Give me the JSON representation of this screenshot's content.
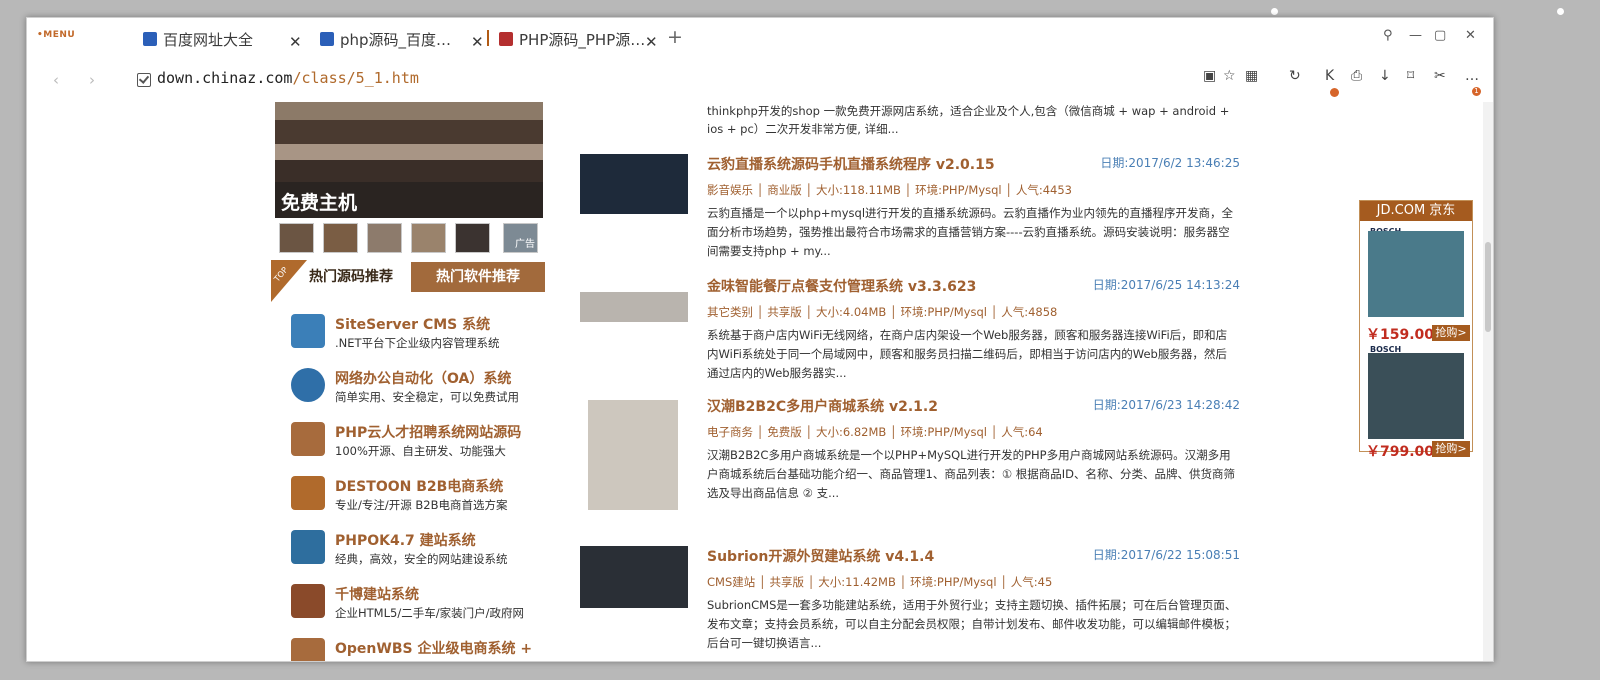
{
  "browser": {
    "menu_label": "•MENU",
    "tabs": [
      {
        "label": "百度网址大全",
        "icon": "paw-icon",
        "close": "✕"
      },
      {
        "label": "php源码_百度…",
        "icon": "paw-icon",
        "close": "✕"
      },
      {
        "label": "PHP源码_PHP源…",
        "icon": "php-icon",
        "close": "✕"
      }
    ],
    "new_tab": "+",
    "window_controls": [
      "⚲",
      "—",
      "▢",
      "✕"
    ],
    "back": "‹",
    "forward": "›",
    "url_host": "down.chinaz.com",
    "url_path": "/class/5_1.htm",
    "toolbar_icons": [
      "extension-icon",
      "star-icon",
      "qr-icon",
      "refresh-icon",
      "k-icon",
      "print-icon",
      "download-icon",
      "bookmark-icon",
      "cut-icon",
      "more-icon"
    ],
    "badge_count": "1"
  },
  "left": {
    "banner_text": "免费主机",
    "thumb_ad": "广告",
    "top_flag": "TOP",
    "tab_active": "热门源码推荐",
    "tab_inactive": "热门软件推荐",
    "items": [
      {
        "title": "SiteServer CMS 系统",
        "desc": ".NET平台下企业级内容管理系统",
        "color": "#3b7fb8"
      },
      {
        "title": "网络办公自动化（OA）系统",
        "desc": "简单实用、安全稳定，可以免费试用",
        "color": "#2f6fa8"
      },
      {
        "title": "PHP云人才招聘系统网站源码",
        "desc": "100%开源、自主研发、功能强大",
        "color": "#a76b3d"
      },
      {
        "title": "DESTOON B2B电商系统",
        "desc": "专业/专注/开源 B2B电商首选方案",
        "color": "#b06a2c"
      },
      {
        "title": "PHPOK4.7 建站系统",
        "desc": "经典，高效，安全的网站建设系统",
        "color": "#2e6e9e"
      },
      {
        "title": "千博建站系统",
        "desc": "企业HTML5/二手车/家装门户/政府网",
        "color": "#8a4a2a"
      },
      {
        "title": "OpenWBS 企业级电商系统 +",
        "desc": "",
        "color": "#a76b3d"
      }
    ]
  },
  "list": {
    "top_desc": "thinkphp开发的shop 一款免费开源网店系统，适合企业及个人,包含（微信商城 + wap + android + ios + pc）二次开发非常方便, 详细...",
    "articles": [
      {
        "title": "云豹直播系统源码手机直播系统程序 v2.0.15",
        "date": "日期:2017/6/2 13:46:25",
        "meta": "影音娱乐 │ 商业版 │ 大小:118.11MB │ 环境:PHP/Mysql │ 人气:4453",
        "desc": "云豹直播是一个以php+mysql进行开发的直播系统源码。云豹直播作为业内领先的直播程序开发商，全面分析市场趋势，强势推出最符合市场需求的直播营销方案----云豹直播系统。源码安装说明：服务器空间需要支持php + my..."
      },
      {
        "title": "金味智能餐厅点餐支付管理系统 v3.3.623",
        "date": "日期:2017/6/25 14:13:24",
        "meta": "其它类别 │ 共享版 │ 大小:4.04MB │ 环境:PHP/Mysql │ 人气:4858",
        "desc": "系统基于商户店内WiFi无线网络，在商户店内架设一个Web服务器，顾客和服务器连接WiFi后，即和店内WiFi系统处于同一个局域网中，顾客和服务员扫描二维码后，即相当于访问店内的Web服务器，然后通过店内的Web服务器实..."
      },
      {
        "title": "汉潮B2B2C多用户商城系统 v2.1.2",
        "date": "日期:2017/6/23 14:28:42",
        "meta": "电子商务 │ 免费版 │ 大小:6.82MB │ 环境:PHP/Mysql │ 人气:64",
        "desc": "汉潮B2B2C多用户商城系统是一个以PHP+MySQL进行开发的PHP多用户商城网站系统源码。汉潮多用户商城系统后台基础功能介绍一、商品管理1、商品列表：① 根据商品ID、名称、分类、品牌、供货商筛选及导出商品信息 ② 支..."
      },
      {
        "title": "Subrion开源外贸建站系统 v4.1.4",
        "date": "日期:2017/6/22 15:08:51",
        "meta": "CMS建站 │ 共享版 │ 大小:11.42MB │ 环境:PHP/Mysql │ 人气:45",
        "desc": "SubrionCMS是一套多功能建站系统，适用于外贸行业；支持主题切换、插件拓展；可在后台管理页面、发布文章；支持会员系统，可以自主分配会员权限；自带计划发布、邮件收发功能，可以编辑邮件模板；后台可一键切换语言..."
      }
    ]
  },
  "ad": {
    "header": "JD.COM 京东",
    "brand": "BOSCH",
    "price1": "￥159.00",
    "price2": "￥799.00",
    "buy": "抢购>"
  },
  "colors": {
    "accent": "#b06a2c",
    "link_blue": "#4a7fb5",
    "brand_brown": "#a55b1f"
  }
}
